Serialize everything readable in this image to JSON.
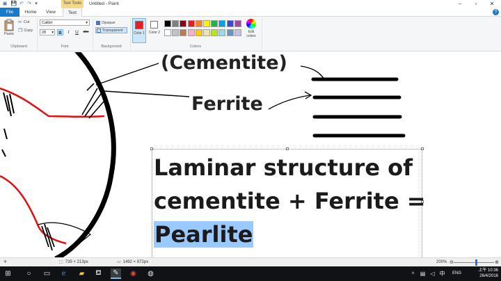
{
  "titlebar": {
    "context_tab": "Text Tools",
    "title": "Untitled - Paint"
  },
  "tabs": {
    "file": "File",
    "home": "Home",
    "view": "View",
    "text": "Text"
  },
  "ribbon": {
    "clipboard": {
      "paste": "Paste",
      "cut": "Cut",
      "copy": "Copy",
      "label": "Clipboard"
    },
    "font": {
      "family": "Calibri",
      "size": "28",
      "bold": "B",
      "italic": "I",
      "underline": "U",
      "strike": "abc",
      "label": "Font"
    },
    "background": {
      "opaque": "Opaque",
      "transparent": "Transparent",
      "label": "Background"
    },
    "colors": {
      "color1_label": "Color 1",
      "color2_label": "Color 2",
      "edit_label": "Edit colors",
      "label": "Colors",
      "color1_value": "#ed1c24",
      "color2_value": "#ffffff",
      "palette": [
        "#000000",
        "#7f7f7f",
        "#880015",
        "#ed1c24",
        "#ff7f27",
        "#fff200",
        "#22b14c",
        "#00a2e8",
        "#3f48cc",
        "#a349a4",
        "#ffffff",
        "#c3c3c3",
        "#b97a57",
        "#ffaec9",
        "#ffc90e",
        "#efe4b0",
        "#b5e61d",
        "#99d9ea",
        "#7092be",
        "#c8bfe7"
      ]
    }
  },
  "canvas": {
    "label_cementite": "(Cementite)",
    "label_ferrite": "Ferrite",
    "textbox_lines": [
      "Laminar structure of",
      "cementite + Ferrite =",
      "Pearlite"
    ],
    "selection_color": "#99c9ff"
  },
  "statusbar": {
    "selection_size": "739 × 213px",
    "image_size": "1492 × 872px",
    "zoom": "200%"
  },
  "taskbar": {
    "language": "ENG",
    "time": "上午 10:36",
    "date": "26/4/2016"
  }
}
